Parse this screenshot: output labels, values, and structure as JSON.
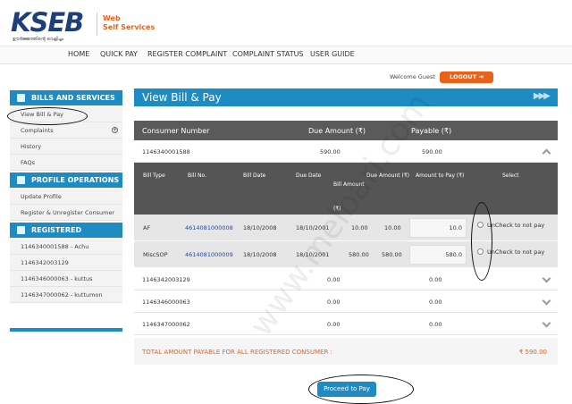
{
  "brand": {
    "logo_text": "KSEB",
    "logo_tagline": "ഊർജ്ജത്തിന്റെ വെളിച്ചം",
    "product_line1": "Web",
    "product_line2": "Self Services",
    "accent": "#e8621a",
    "primary": "#1e8bc3"
  },
  "nav": [
    "HOME",
    "QUICK PAY",
    "REGISTER COMPLAINT",
    "COMPLAINT STATUS",
    "USER GUIDE"
  ],
  "user": {
    "welcome": "Welcome Guest",
    "logout": "LOGOUT"
  },
  "sidebar": {
    "bills_header": "BILLS AND SERVICES",
    "bills_items": [
      "View Bill & Pay",
      "Complaints",
      "History",
      "FAQs"
    ],
    "profile_header": "PROFILE OPERATIONS",
    "profile_items": [
      "Update Profile",
      "Register & Unregister Consumer"
    ],
    "consumers_header": "REGISTERED CONSUMERS",
    "consumers_items": [
      "1146340001588 - Achu",
      "1146342003129",
      "1146346000063 - kuttus",
      "1146347000062 - kuttumon"
    ]
  },
  "main": {
    "title": "View Bill & Pay",
    "columns": [
      "Consumer Number",
      "Due Amount (₹)",
      "Payable (₹)"
    ],
    "consumers": [
      {
        "number": "1146340001588",
        "due": "590.00",
        "payable": "590.00"
      },
      {
        "number": "1146342003129",
        "due": "0.00",
        "payable": "0.00"
      },
      {
        "number": "1146346000063",
        "due": "0.00",
        "payable": "0.00"
      },
      {
        "number": "1146347000062",
        "due": "0.00",
        "payable": "0.00"
      }
    ],
    "bill_columns": [
      "Bill Type",
      "Bill No.",
      "Bill Date",
      "Due Date",
      "Bill Amount (₹)",
      "Due Amount (₹)",
      "Amount to Pay (₹)",
      "Select"
    ],
    "bills": [
      {
        "type": "AF",
        "no": "4614081000008",
        "date": "18/10/2008",
        "due_date": "18/10/2001",
        "amount": "10.00",
        "due": "10.00",
        "pay": "10.0",
        "select": "UnCheck to not pay"
      },
      {
        "type": "MiscSOP",
        "no": "4614081000009",
        "date": "18/10/2008",
        "due_date": "18/10/2001",
        "amount": "580.00",
        "due": "580.00",
        "pay": "580.0",
        "select": "UnCheck to not pay"
      }
    ],
    "total_label": "TOTAL AMOUNT PAYABLE FOR ALL REGISTERED CONSUMER :",
    "total_value": "₹ 590.00",
    "proceed": "Proceed to Pay"
  },
  "watermark": "www.melbari.com"
}
